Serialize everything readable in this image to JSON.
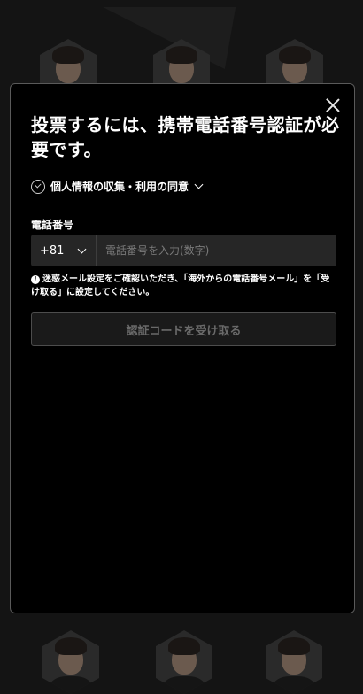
{
  "modal": {
    "title": "投票するには、携帯電話番号認証が必要です。",
    "consent_label": "個人情報の収集・利用の同意",
    "phone_label": "電話番号",
    "country_code": "+81",
    "phone_placeholder": "電話番号を入力(数字)",
    "notice": "迷惑メール設定をご確認いただき、「海外からの電話番号メール」を「受け取る」に設定してください。",
    "notice_icon": "!",
    "submit_label": "認証コードを受け取る"
  },
  "colors": {
    "background": "#141414",
    "modal": "#000000",
    "input": "#262626",
    "disabled_text": "#6a6a6a"
  },
  "icons": [
    "close-icon",
    "check-circle-icon",
    "chevron-down-icon",
    "info-icon"
  ]
}
